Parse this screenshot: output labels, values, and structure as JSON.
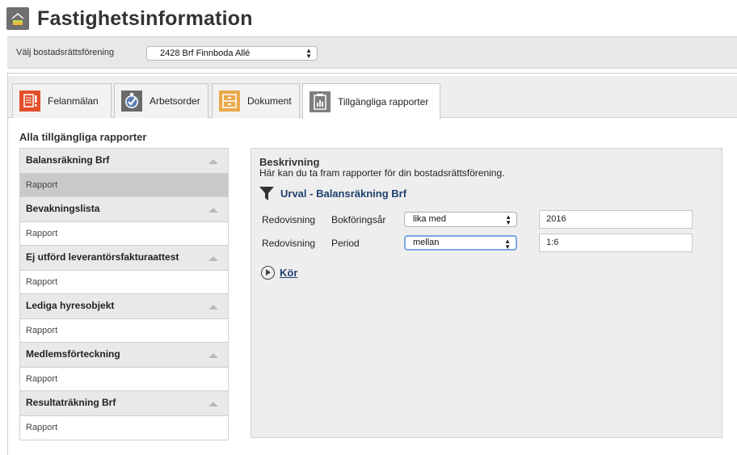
{
  "app": {
    "title": "Fastighetsinformation",
    "logo_icon": "house-roof-icon"
  },
  "association": {
    "label": "Välj bostadsrättsförening",
    "selected": "2428 Brf Finnboda Allé"
  },
  "tabs": [
    {
      "label": "Felanmälan",
      "icon": "fault-report-icon",
      "color": "#e2502b",
      "active": false
    },
    {
      "label": "Arbetsorder",
      "icon": "work-order-check-icon",
      "color": "#5b7fb8",
      "active": false
    },
    {
      "label": "Dokument",
      "icon": "document-icon",
      "color": "#e9a84a",
      "active": false
    },
    {
      "label": "Tillgängliga rapporter",
      "icon": "report-chart-icon",
      "color": "#7f7f7f",
      "active": true
    }
  ],
  "reports": {
    "title": "Alla tillgängliga rapporter",
    "groups": [
      {
        "name": "Balansräkning Brf",
        "item": "Rapport",
        "selected": true
      },
      {
        "name": "Bevakningslista",
        "item": "Rapport",
        "selected": false
      },
      {
        "name": "Ej utförd leverantörsfakturaattest",
        "item": "Rapport",
        "selected": false
      },
      {
        "name": "Lediga hyresobjekt",
        "item": "Rapport",
        "selected": false
      },
      {
        "name": "Medlemsförteckning",
        "item": "Rapport",
        "selected": false
      },
      {
        "name": "Resultaträkning Brf",
        "item": "Rapport",
        "selected": false
      }
    ]
  },
  "details": {
    "desc_title": "Beskrivning",
    "desc_text": "Här kan du ta fram rapporter för din bostadsrättsförening.",
    "filter_title": "Urval - Balansräkning Brf",
    "rows": [
      {
        "label1": "Redovisning",
        "label2": "Bokföringsår",
        "operator": "lika med",
        "value": "2016",
        "focused": false
      },
      {
        "label1": "Redovisning",
        "label2": "Period",
        "operator": "mellan",
        "value": "1:6",
        "focused": true
      }
    ],
    "run_label": "Kör"
  },
  "colors": {
    "accent_link": "#1f3f6e",
    "focus_ring": "#7aa7e5",
    "selected_item": "#c9c9c9"
  }
}
